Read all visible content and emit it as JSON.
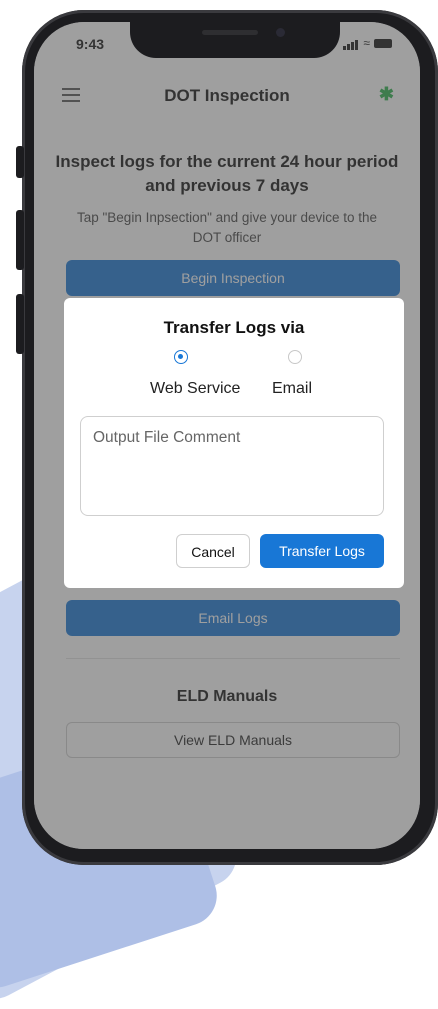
{
  "status_bar": {
    "time": "9:43"
  },
  "nav": {
    "title": "DOT Inspection",
    "menu_icon": "hamburger-icon",
    "bluetooth_icon": "bluetooth-icon"
  },
  "main": {
    "heading": "Inspect logs for the current 24 hour period and previous 7 days",
    "instructions": "Tap \"Begin Inpsection\" and give your device to the DOT officer",
    "begin_button": "Begin Inspection",
    "email_button": "Email Logs",
    "manuals_title": "ELD Manuals",
    "manuals_button": "View ELD Manuals"
  },
  "modal": {
    "title": "Transfer Logs via",
    "options": [
      {
        "label": "Web Service",
        "selected": true
      },
      {
        "label": "Email",
        "selected": false
      }
    ],
    "comment_placeholder": "Output File Comment",
    "cancel_label": "Cancel",
    "transfer_label": "Transfer Logs"
  },
  "colors": {
    "primary": "#1877d6",
    "bluetooth": "#2bb24c",
    "overlay": "#505050"
  }
}
